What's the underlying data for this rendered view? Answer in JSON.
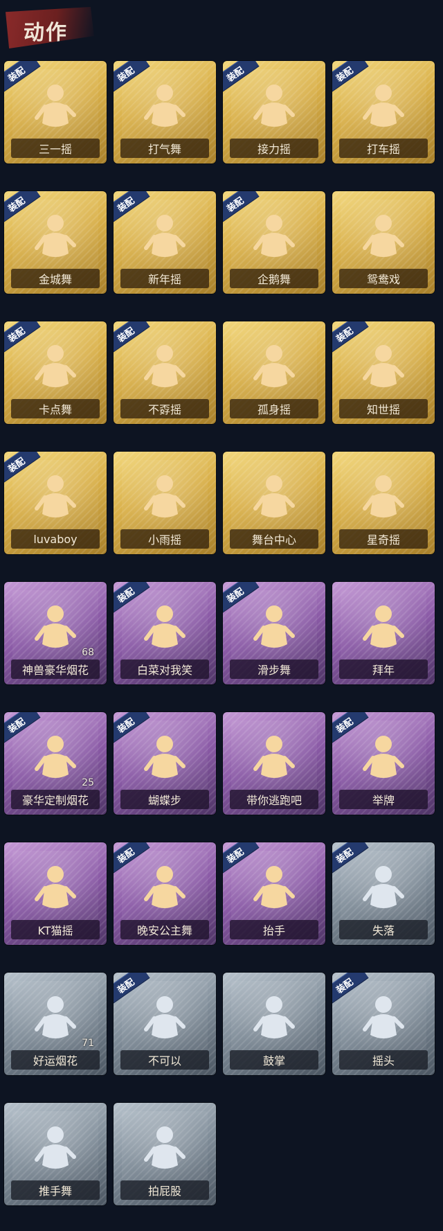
{
  "section_title": "动作",
  "items": [
    {
      "name": "三一摇",
      "tier": "gold",
      "equipped": true,
      "equipped_label": "装配"
    },
    {
      "name": "打气舞",
      "tier": "gold",
      "equipped": true,
      "equipped_label": "装配"
    },
    {
      "name": "接力摇",
      "tier": "gold",
      "equipped": true,
      "equipped_label": "装配"
    },
    {
      "name": "打车摇",
      "tier": "gold",
      "equipped": true,
      "equipped_label": "装配"
    },
    {
      "name": "金城舞",
      "tier": "gold",
      "equipped": true,
      "equipped_label": "装配"
    },
    {
      "name": "新年摇",
      "tier": "gold",
      "equipped": true,
      "equipped_label": "装配"
    },
    {
      "name": "企鹅舞",
      "tier": "gold",
      "equipped": true,
      "equipped_label": "装配"
    },
    {
      "name": "鸳鸯戏",
      "tier": "gold",
      "equipped": false
    },
    {
      "name": "卡点舞",
      "tier": "gold",
      "equipped": true,
      "equipped_label": "装配"
    },
    {
      "name": "不孬摇",
      "tier": "gold",
      "equipped": true,
      "equipped_label": "装配"
    },
    {
      "name": "孤身摇",
      "tier": "gold",
      "equipped": false
    },
    {
      "name": "知世摇",
      "tier": "gold",
      "equipped": true,
      "equipped_label": "装配"
    },
    {
      "name": "luvaboy",
      "tier": "gold",
      "equipped": true,
      "equipped_label": "装配"
    },
    {
      "name": "小雨摇",
      "tier": "gold",
      "equipped": false
    },
    {
      "name": "舞台中心",
      "tier": "gold",
      "equipped": false
    },
    {
      "name": "星奇摇",
      "tier": "gold",
      "equipped": false
    },
    {
      "name": "神兽豪华烟花",
      "tier": "purple",
      "equipped": false,
      "count": "68"
    },
    {
      "name": "白菜对我笑",
      "tier": "purple",
      "equipped": true,
      "equipped_label": "装配"
    },
    {
      "name": "滑步舞",
      "tier": "purple",
      "equipped": true,
      "equipped_label": "装配"
    },
    {
      "name": "拜年",
      "tier": "purple",
      "equipped": false
    },
    {
      "name": "豪华定制烟花",
      "tier": "purple",
      "equipped": true,
      "equipped_label": "装配",
      "count": "25"
    },
    {
      "name": "蝴蝶步",
      "tier": "purple",
      "equipped": true,
      "equipped_label": "装配"
    },
    {
      "name": "带你逃跑吧",
      "tier": "purple",
      "equipped": false
    },
    {
      "name": "举牌",
      "tier": "purple",
      "equipped": true,
      "equipped_label": "装配"
    },
    {
      "name": "KT猫摇",
      "tier": "purple",
      "equipped": false
    },
    {
      "name": "晚安公主舞",
      "tier": "purple",
      "equipped": true,
      "equipped_label": "装配"
    },
    {
      "name": "抬手",
      "tier": "purple",
      "equipped": true,
      "equipped_label": "装配"
    },
    {
      "name": "失落",
      "tier": "gray",
      "equipped": true,
      "equipped_label": "装配"
    },
    {
      "name": "好运烟花",
      "tier": "gray",
      "equipped": false,
      "count": "71"
    },
    {
      "name": "不可以",
      "tier": "gray",
      "equipped": true,
      "equipped_label": "装配"
    },
    {
      "name": "鼓掌",
      "tier": "gray",
      "equipped": false
    },
    {
      "name": "摇头",
      "tier": "gray",
      "equipped": true,
      "equipped_label": "装配"
    },
    {
      "name": "推手舞",
      "tier": "gray",
      "equipped": false
    },
    {
      "name": "拍屁股",
      "tier": "gray",
      "equipped": false
    }
  ],
  "colors": {
    "background": "#0d1422",
    "gold": "#d9b04a",
    "purple": "#8a5aa6",
    "gray": "#7f8c98",
    "badge": "#243a6e",
    "figure_gold": "#f6d7a0",
    "figure_gray": "#dfe6ee"
  }
}
